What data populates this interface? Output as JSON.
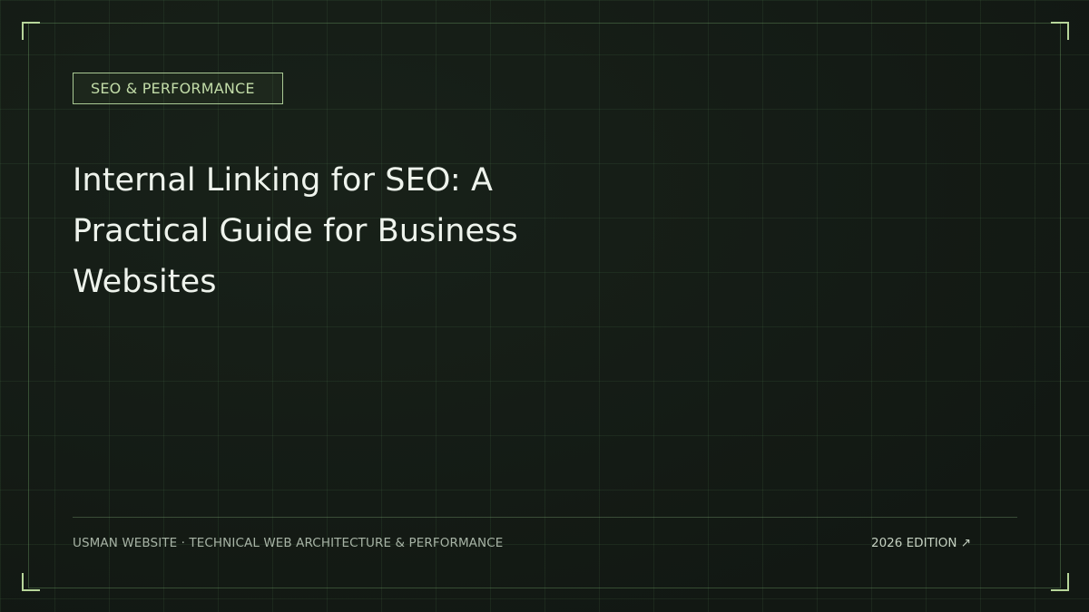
{
  "category_badge": "SEO & PERFORMANCE",
  "title": "Internal Linking for SEO: A Practical Guide for Business Websites",
  "footer": {
    "site_line": "USMAN WEBSITE · TECHNICAL WEB ARCHITECTURE & PERFORMANCE",
    "edition": "2026 EDITION ↗"
  },
  "colors": {
    "background": "#131a14",
    "accent": "#b7d69a",
    "title_text": "#eef3ec"
  }
}
